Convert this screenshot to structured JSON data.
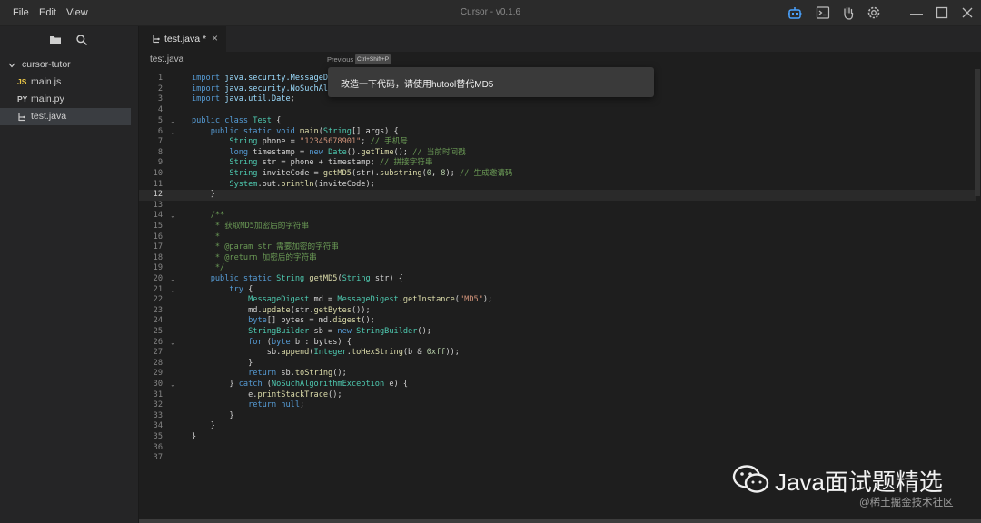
{
  "menu": [
    "File",
    "Edit",
    "View"
  ],
  "window_title": "Cursor - v0.1.6",
  "icons": {
    "robot": "robot-icon",
    "terminal": "terminal-icon",
    "hand": "hand-icon",
    "settings": "gear-icon",
    "files": "files-icon",
    "search": "search-icon"
  },
  "sidebar": {
    "folder": "cursor-tutor",
    "files": [
      {
        "badge": "JS",
        "badge_color": "#e8c547",
        "name": "main.js"
      },
      {
        "badge": "PY",
        "badge_color": "#c8c8c8",
        "name": "main.py"
      },
      {
        "badge": "",
        "badge_color": "#c8c8c8",
        "name": "test.java"
      }
    ]
  },
  "tab": {
    "label": "test.java *",
    "close": "×"
  },
  "breadcrumb": "test.java",
  "previous": {
    "label": "Previous",
    "shortcut": "Ctrl+Shift+P"
  },
  "popup": {
    "text": "改造一下代码，请使用hutool替代MD5"
  },
  "editor": {
    "current_line": 12,
    "line_numbers": [
      "1",
      "2",
      "3",
      "4",
      "5",
      "6",
      "7",
      "8",
      "9",
      "10",
      "11",
      "12",
      "13",
      "14",
      "15",
      "16",
      "17",
      "18",
      "19",
      "20",
      "21",
      "22",
      "23",
      "24",
      "25",
      "26",
      "27",
      "28",
      "29",
      "30",
      "31",
      "32",
      "33",
      "34",
      "35",
      "36",
      "37"
    ]
  },
  "watermark": {
    "title": "Java面试题精选",
    "sub": "@稀土掘金技术社区"
  },
  "colors": {
    "accent": "#569cd6",
    "background": "#1e1e1e"
  }
}
